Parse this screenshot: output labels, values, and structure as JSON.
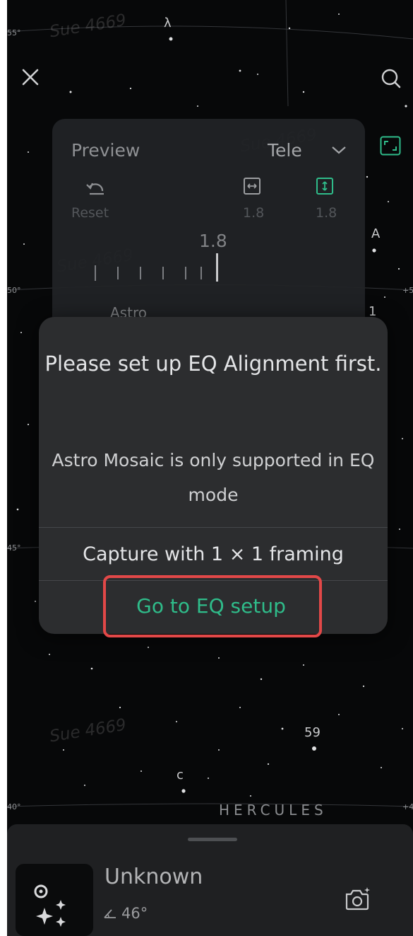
{
  "overlay_watermark": "Sue 4669",
  "map": {
    "edge_labels": [
      "55°",
      "50°",
      "45°",
      "40°",
      "+5",
      "+4"
    ],
    "star_labels": {
      "lambda": "λ",
      "a": "A",
      "n59": "59",
      "c": "c",
      "one": "1"
    },
    "constellation": "HERCULES"
  },
  "preview_panel": {
    "title": "Preview",
    "lens": "Tele",
    "reset_label": "Reset",
    "width_value": "1.8",
    "height_value": "1.8",
    "scale_value": "1.8",
    "mode_label": "Astro"
  },
  "dialog": {
    "title": "Please set up EQ Alignment first.",
    "message": "Astro Mosaic is only supported in EQ mode",
    "capture_button": "Capture with 1 × 1 framing",
    "eq_button": "Go to EQ setup"
  },
  "bottom": {
    "object_name": "Unknown",
    "altitude": "46°"
  },
  "colors": {
    "accent": "#2fbc8a",
    "highlight": "#e24848",
    "dialog_bg": "#2c2d2f",
    "sky_bg": "#070809"
  }
}
